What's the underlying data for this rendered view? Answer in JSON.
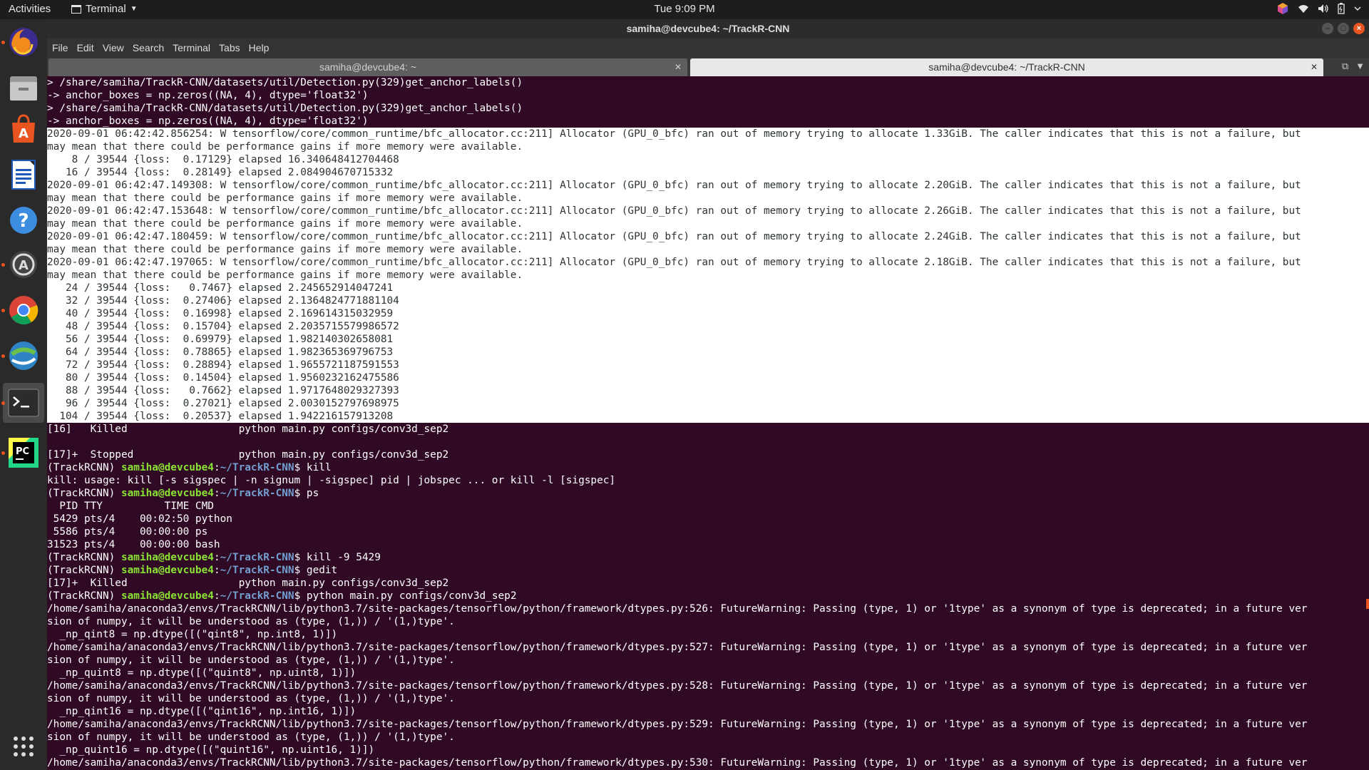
{
  "topbar": {
    "activities": "Activities",
    "app_name": "Terminal",
    "clock": "Tue  9:09 PM"
  },
  "window": {
    "title": "samiha@devcube4: ~/TrackR-CNN"
  },
  "menu": [
    "File",
    "Edit",
    "View",
    "Search",
    "Terminal",
    "Tabs",
    "Help"
  ],
  "tabs": [
    {
      "label": "samiha@devcube4: ~",
      "active": false
    },
    {
      "label": "samiha@devcube4: ~/TrackR-CNN",
      "active": true
    }
  ],
  "dock": {
    "apps": [
      "firefox-icon",
      "files-icon",
      "software-center-icon",
      "writer-icon",
      "help-icon",
      "updater-icon",
      "chrome-icon",
      "network-app-icon",
      "terminal-icon",
      "pycharm-icon",
      "show-apps-icon"
    ]
  },
  "prompt": {
    "env": "(TrackRCNN) ",
    "user": "samiha@devcube4",
    "path": "~/TrackR-CNN"
  },
  "colors": {
    "background": "#300a24",
    "prompt_user": "#8ae234",
    "prompt_path": "#729fcf",
    "accent": "#e95420"
  },
  "terminal": {
    "lines": [
      {
        "t": "> /share/samiha/TrackR-CNN/datasets/util/Detection.py(329)get_anchor_labels()"
      },
      {
        "t": "-> anchor_boxes = np.zeros((NA, 4), dtype='float32')"
      },
      {
        "t": "> /share/samiha/TrackR-CNN/datasets/util/Detection.py(329)get_anchor_labels()"
      },
      {
        "t": "-> anchor_boxes = np.zeros((NA, 4), dtype='float32')"
      },
      {
        "t": "2020-09-01 06:42:42.856254: W tensorflow/core/common_runtime/bfc_allocator.cc:211] Allocator (GPU_0_bfc) ran out of memory trying to allocate 1.33GiB. The caller indicates that this is not a failure, but",
        "sel": true
      },
      {
        "t": "may mean that there could be performance gains if more memory were available.",
        "sel": true
      },
      {
        "t": "    8 / 39544 {loss:  0.17129} elapsed 16.340648412704468",
        "sel": true
      },
      {
        "t": "   16 / 39544 {loss:  0.28149} elapsed 2.084904670715332",
        "sel": true
      },
      {
        "t": "2020-09-01 06:42:47.149308: W tensorflow/core/common_runtime/bfc_allocator.cc:211] Allocator (GPU_0_bfc) ran out of memory trying to allocate 2.20GiB. The caller indicates that this is not a failure, but",
        "sel": true
      },
      {
        "t": "may mean that there could be performance gains if more memory were available.",
        "sel": true
      },
      {
        "t": "2020-09-01 06:42:47.153648: W tensorflow/core/common_runtime/bfc_allocator.cc:211] Allocator (GPU_0_bfc) ran out of memory trying to allocate 2.26GiB. The caller indicates that this is not a failure, but",
        "sel": true
      },
      {
        "t": "may mean that there could be performance gains if more memory were available.",
        "sel": true
      },
      {
        "t": "2020-09-01 06:42:47.180459: W tensorflow/core/common_runtime/bfc_allocator.cc:211] Allocator (GPU_0_bfc) ran out of memory trying to allocate 2.24GiB. The caller indicates that this is not a failure, but",
        "sel": true
      },
      {
        "t": "may mean that there could be performance gains if more memory were available.",
        "sel": true
      },
      {
        "t": "2020-09-01 06:42:47.197065: W tensorflow/core/common_runtime/bfc_allocator.cc:211] Allocator (GPU_0_bfc) ran out of memory trying to allocate 2.18GiB. The caller indicates that this is not a failure, but",
        "sel": true
      },
      {
        "t": "may mean that there could be performance gains if more memory were available.",
        "sel": true
      },
      {
        "t": "   24 / 39544 {loss:   0.7467} elapsed 2.245652914047241",
        "sel": true
      },
      {
        "t": "   32 / 39544 {loss:  0.27406} elapsed 2.1364824771881104",
        "sel": true
      },
      {
        "t": "   40 / 39544 {loss:  0.16998} elapsed 2.169614315032959",
        "sel": true
      },
      {
        "t": "   48 / 39544 {loss:  0.15704} elapsed 2.2035715579986572",
        "sel": true
      },
      {
        "t": "   56 / 39544 {loss:  0.69979} elapsed 1.982140302658081",
        "sel": true
      },
      {
        "t": "   64 / 39544 {loss:  0.78865} elapsed 1.982365369796753",
        "sel": true
      },
      {
        "t": "   72 / 39544 {loss:  0.28894} elapsed 1.9655721187591553",
        "sel": true
      },
      {
        "t": "   80 / 39544 {loss:  0.14504} elapsed 1.9560232162475586",
        "sel": true
      },
      {
        "t": "   88 / 39544 {loss:   0.7662} elapsed 1.9717648029327393",
        "sel": true
      },
      {
        "t": "   96 / 39544 {loss:  0.27021} elapsed 2.0030152797698975",
        "sel": true
      },
      {
        "t": "  104 / 39544 {loss:  0.20537} elapsed 1.942216157913208",
        "sel": true
      },
      {
        "t": "[16]   Killed                  python main.py configs/conv3d_sep2"
      },
      {
        "t": ""
      },
      {
        "t": "[17]+  Stopped                 python main.py configs/conv3d_sep2"
      },
      {
        "cmd": "kill"
      },
      {
        "t": "kill: usage: kill [-s sigspec | -n signum | -sigspec] pid | jobspec ... or kill -l [sigspec]"
      },
      {
        "cmd": "ps"
      },
      {
        "t": "  PID TTY          TIME CMD"
      },
      {
        "t": " 5429 pts/4    00:02:50 python"
      },
      {
        "t": " 5586 pts/4    00:00:00 ps"
      },
      {
        "t": "31523 pts/4    00:00:00 bash"
      },
      {
        "cmd": "kill -9 5429"
      },
      {
        "cmd": "gedit"
      },
      {
        "t": "[17]+  Killed                  python main.py configs/conv3d_sep2"
      },
      {
        "cmd": "python main.py configs/conv3d_sep2"
      },
      {
        "t": "/home/samiha/anaconda3/envs/TrackRCNN/lib/python3.7/site-packages/tensorflow/python/framework/dtypes.py:526: FutureWarning: Passing (type, 1) or '1type' as a synonym of type is deprecated; in a future ver"
      },
      {
        "t": "sion of numpy, it will be understood as (type, (1,)) / '(1,)type'."
      },
      {
        "t": "  _np_qint8 = np.dtype([(\"qint8\", np.int8, 1)])"
      },
      {
        "t": "/home/samiha/anaconda3/envs/TrackRCNN/lib/python3.7/site-packages/tensorflow/python/framework/dtypes.py:527: FutureWarning: Passing (type, 1) or '1type' as a synonym of type is deprecated; in a future ver"
      },
      {
        "t": "sion of numpy, it will be understood as (type, (1,)) / '(1,)type'."
      },
      {
        "t": "  _np_quint8 = np.dtype([(\"quint8\", np.uint8, 1)])"
      },
      {
        "t": "/home/samiha/anaconda3/envs/TrackRCNN/lib/python3.7/site-packages/tensorflow/python/framework/dtypes.py:528: FutureWarning: Passing (type, 1) or '1type' as a synonym of type is deprecated; in a future ver"
      },
      {
        "t": "sion of numpy, it will be understood as (type, (1,)) / '(1,)type'."
      },
      {
        "t": "  _np_qint16 = np.dtype([(\"qint16\", np.int16, 1)])"
      },
      {
        "t": "/home/samiha/anaconda3/envs/TrackRCNN/lib/python3.7/site-packages/tensorflow/python/framework/dtypes.py:529: FutureWarning: Passing (type, 1) or '1type' as a synonym of type is deprecated; in a future ver"
      },
      {
        "t": "sion of numpy, it will be understood as (type, (1,)) / '(1,)type'."
      },
      {
        "t": "  _np_quint16 = np.dtype([(\"quint16\", np.uint16, 1)])"
      },
      {
        "t": "/home/samiha/anaconda3/envs/TrackRCNN/lib/python3.7/site-packages/tensorflow/python/framework/dtypes.py:530: FutureWarning: Passing (type, 1) or '1type' as a synonym of type is deprecated; in a future ver"
      }
    ]
  }
}
